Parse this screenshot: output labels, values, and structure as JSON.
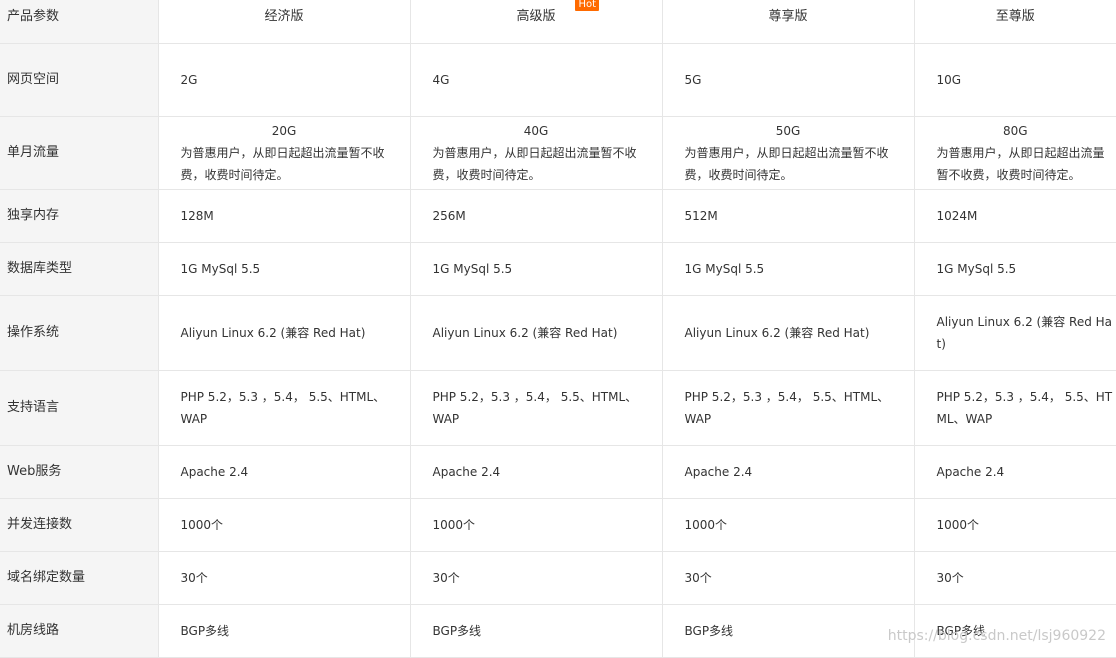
{
  "header": {
    "label": "产品参数",
    "plans": [
      "经济版",
      "高级版",
      "尊享版",
      "至尊版"
    ],
    "hot_badge": "Hot"
  },
  "rows": [
    {
      "label": "网页空间",
      "values": [
        "2G",
        "4G",
        "5G",
        "10G"
      ]
    },
    {
      "label": "单月流量",
      "values": [
        "20G",
        "40G",
        "50G",
        "80G"
      ],
      "notes": [
        [
          "为普惠用户，从即日起超出流量暂不收",
          "费，收费时间待定。"
        ],
        [
          "为普惠用户，从即日起超出流量暂不收",
          "费，收费时间待定。"
        ],
        [
          "为普惠用户，从即日起超出流量暂不收",
          "费，收费时间待定。"
        ],
        [
          "为普惠用户，从即日起超出流量",
          "暂不收费，收费时间待定。"
        ]
      ]
    },
    {
      "label": "独享内存",
      "values": [
        "128M",
        "256M",
        "512M",
        "1024M"
      ]
    },
    {
      "label": "数据库类型",
      "values": [
        "1G MySql 5.5",
        "1G MySql 5.5",
        "1G MySql 5.5",
        "1G MySql 5.5"
      ]
    },
    {
      "label": "操作系统",
      "values": [
        "Aliyun Linux 6.2 (兼容 Red Hat)",
        "Aliyun Linux 6.2 (兼容 Red Hat)",
        "Aliyun Linux 6.2 (兼容 Red Hat)"
      ],
      "last_lines": [
        "Aliyun Linux 6.2 (兼容 Red Ha",
        "t)"
      ]
    },
    {
      "label": "支持语言",
      "lines": [
        [
          "PHP 5.2，5.3 ，5.4， 5.5、HTML、",
          "WAP"
        ],
        [
          "PHP 5.2，5.3 ，5.4， 5.5、HTML、",
          "WAP"
        ],
        [
          "PHP 5.2，5.3 ，5.4， 5.5、HTML、",
          "WAP"
        ],
        [
          "PHP 5.2，5.3 ，5.4， 5.5、HT",
          "ML、WAP"
        ]
      ]
    },
    {
      "label": "Web服务",
      "values": [
        "Apache 2.4",
        "Apache 2.4",
        "Apache 2.4",
        "Apache 2.4"
      ]
    },
    {
      "label": "并发连接数",
      "values": [
        "1000个",
        "1000个",
        "1000个",
        "1000个"
      ]
    },
    {
      "label": "域名绑定数量",
      "values": [
        "30个",
        "30个",
        "30个",
        "30个"
      ]
    },
    {
      "label": "机房线路",
      "values": [
        "BGP多线",
        "BGP多线",
        "BGP多线",
        "BGP多线"
      ]
    }
  ],
  "watermark": "https://blog.csdn.net/lsj960922"
}
